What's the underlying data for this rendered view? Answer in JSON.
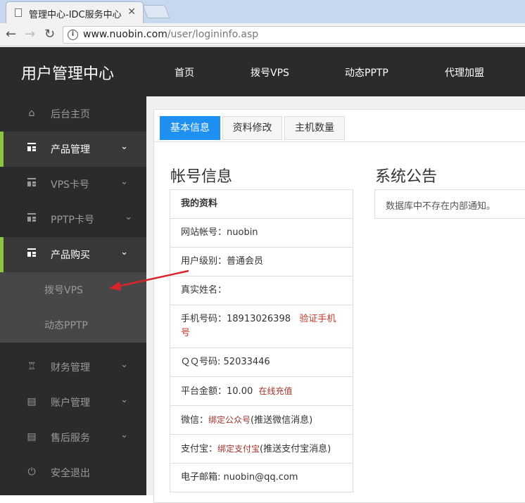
{
  "browser": {
    "tab_title": "管理中心-IDC服务中心",
    "url_host": "www.nuobin.com",
    "url_path": "/user/logininfo.asp"
  },
  "header": {
    "brand": "用户管理中心",
    "nav": [
      "首页",
      "拨号VPS",
      "动态PPTP",
      "代理加盟"
    ]
  },
  "sidebar": {
    "items": [
      {
        "label": "后台主页",
        "icon": "home-icon"
      },
      {
        "label": "产品管理",
        "icon": "grid-icon"
      },
      {
        "label": "VPS卡号",
        "icon": "grid-icon"
      },
      {
        "label": "PPTP卡号",
        "icon": "grid-icon"
      },
      {
        "label": "产品购买",
        "icon": "grid-icon"
      },
      {
        "label": "拨号VPS"
      },
      {
        "label": "动态PPTP"
      },
      {
        "label": "财务管理",
        "icon": "money-bag-icon"
      },
      {
        "label": "账户管理",
        "icon": "id-card-icon"
      },
      {
        "label": "售后服务",
        "icon": "id-card-icon"
      },
      {
        "label": "安全退出",
        "icon": "power-icon"
      }
    ],
    "accent_color": "#8cc63f"
  },
  "main": {
    "tabs": [
      "基本信息",
      "资料修改",
      "主机数量"
    ],
    "account_title": "帐号信息",
    "notice_title": "系统公告",
    "notice_text": "数据库中不存在内部通知。",
    "profile_header": "我的资料",
    "rows": {
      "account_label": "网站帐号：",
      "account_value": "nuobin",
      "level_label": "用户级别：",
      "level_value": "普通会员",
      "realname_label": "真实姓名：",
      "phone_label": "手机号码：",
      "phone_value": "18913026398",
      "phone_verify": "验证手机号",
      "qq_label": "ＱＱ号码:",
      "qq_value": "52033446",
      "balance_label": "平台金额：",
      "balance_value": "10.00",
      "recharge": "在线充值",
      "wechat_label": "微信：",
      "wechat_link": "绑定公众号",
      "wechat_note": "(推送微信消息)",
      "alipay_label": "支付宝：",
      "alipay_link": "绑定支付宝",
      "alipay_note": "(推送支付宝消息)",
      "email_label": "电子邮箱:",
      "email_value": "nuobin@qq.com"
    },
    "primary_color": "#1e90f2"
  }
}
